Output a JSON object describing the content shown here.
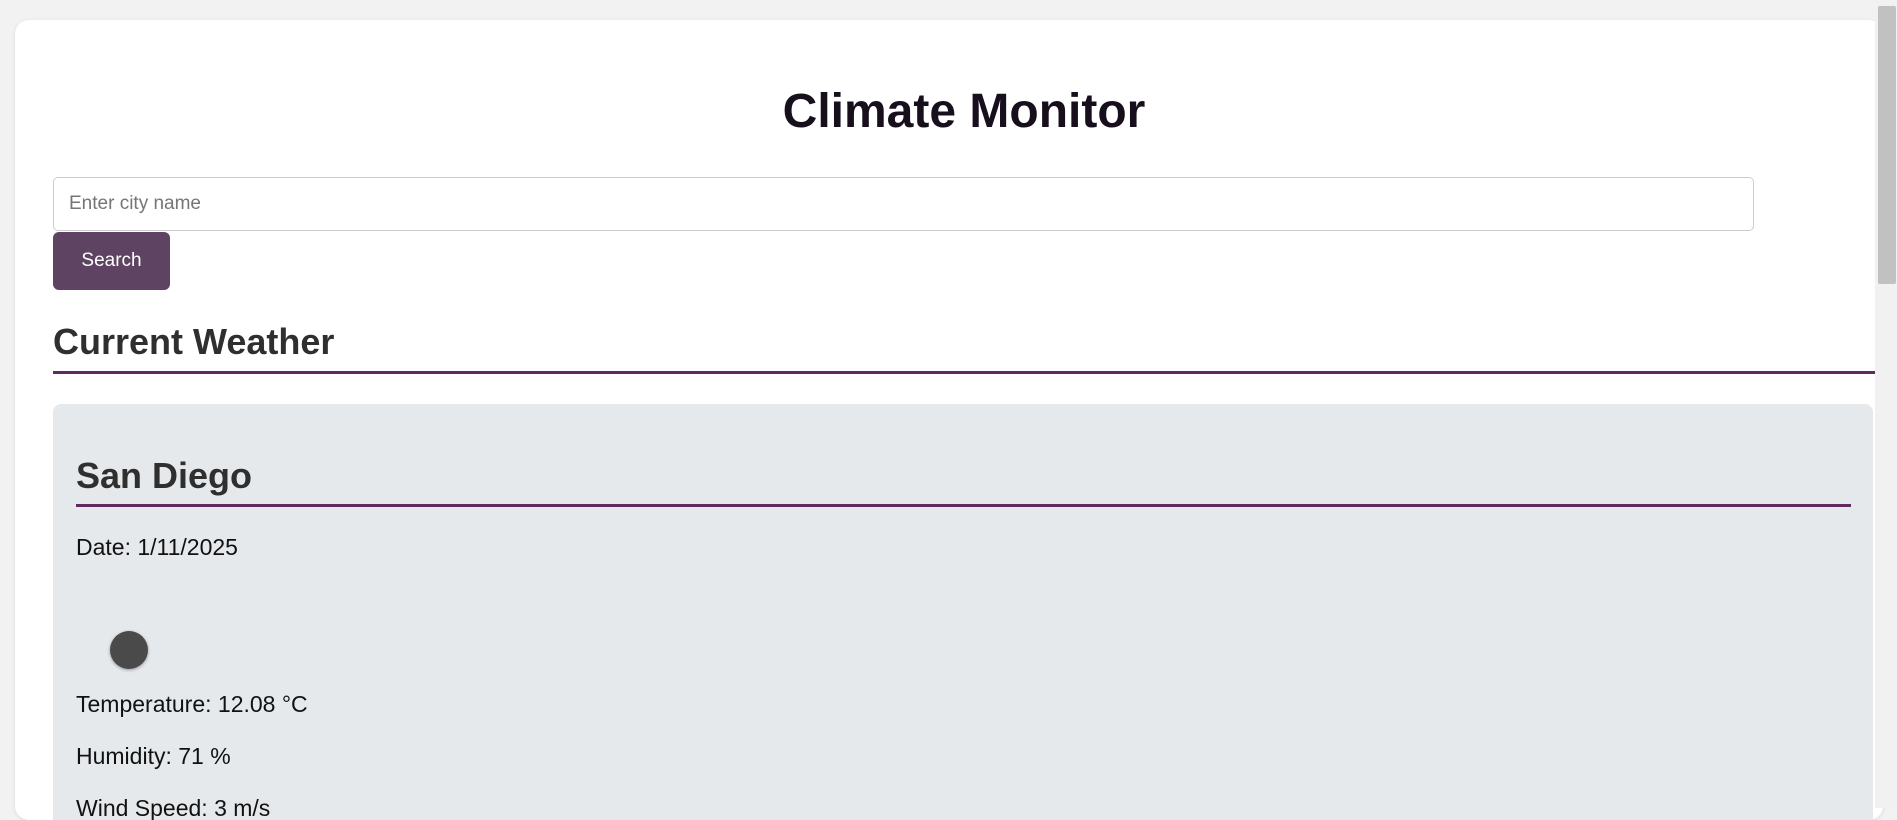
{
  "header": {
    "title": "Climate Monitor"
  },
  "search": {
    "placeholder": "Enter city name",
    "value": "",
    "button_label": "Search"
  },
  "current_weather": {
    "section_title": "Current Weather",
    "city": "San Diego",
    "date": "Date: 1/11/2025",
    "icon": "weather-condition-icon",
    "temperature": "Temperature: 12.08 °C",
    "humidity": "Humidity: 71 %",
    "wind_speed": "Wind Speed: 3 m/s"
  },
  "colors": {
    "accent": "#5d2b5f",
    "button": "#5f4363",
    "card_background": "#e6e9ec"
  }
}
